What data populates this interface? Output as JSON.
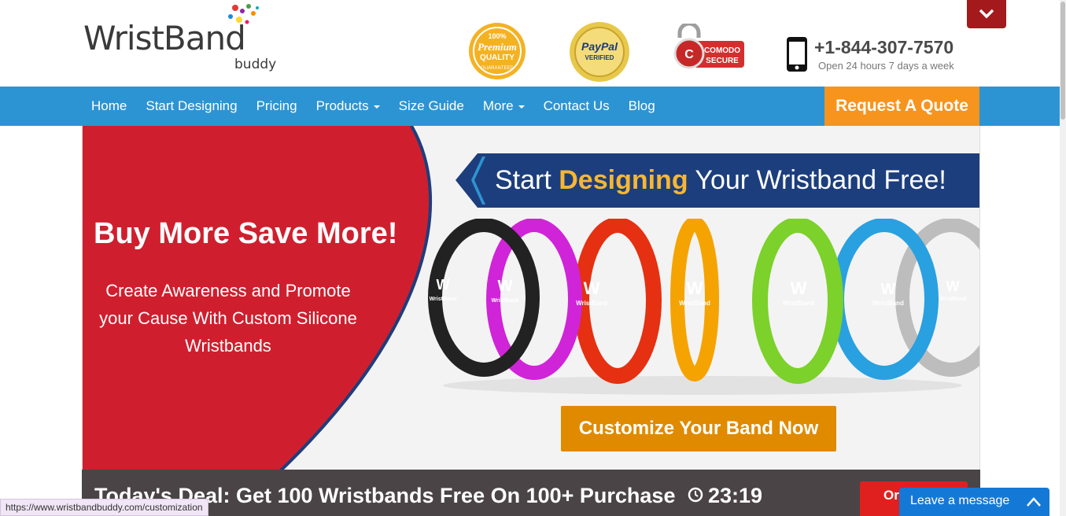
{
  "logo": {
    "word": "WristBand",
    "sub": "buddy"
  },
  "badges": {
    "quality": {
      "line1": "100%",
      "line2": "Premium",
      "line3": "QUALITY",
      "line4": "GUARANTEED"
    },
    "paypal": {
      "line1": "PayPal",
      "line2": "VERIFIED"
    },
    "comodo": {
      "line1": "COMODO",
      "line2": "SECURE"
    }
  },
  "contact": {
    "phone": "+1-844-307-7570",
    "hours": "Open 24 hours 7 days a week"
  },
  "nav": {
    "items": [
      {
        "label": "Home",
        "dropdown": false
      },
      {
        "label": "Start Designing",
        "dropdown": false
      },
      {
        "label": "Pricing",
        "dropdown": false
      },
      {
        "label": "Products",
        "dropdown": true
      },
      {
        "label": "Size Guide",
        "dropdown": false
      },
      {
        "label": "More",
        "dropdown": true
      },
      {
        "label": "Contact Us",
        "dropdown": false
      },
      {
        "label": "Blog",
        "dropdown": false
      }
    ],
    "quote_button": "Request A Quote"
  },
  "hero": {
    "headline": "Buy More Save More!",
    "subtext": "Create Awareness and Promote your Cause With Custom Silicone Wristbands",
    "banner_before": "Start ",
    "banner_highlight": "Designing",
    "banner_after": " Your Wristband  Free!",
    "band_label": "WristBand",
    "cta_button": "Customize Your Band Now"
  },
  "deal": {
    "text": "Today's Deal: Get 100 Wristbands Free On 100+ Purchase",
    "timer": "23:19",
    "order_button": "Order"
  },
  "status_bar": {
    "url": "https://www.wristbandbuddy.com/customization"
  },
  "chat": {
    "label": "Leave a message"
  },
  "colors": {
    "nav_blue": "#2d94d3",
    "quote_orange": "#f7941d",
    "hero_red": "#cf1f2e",
    "banner_navy": "#1d3e7c",
    "cta_orange": "#e08a00",
    "deal_gray": "#4a4446",
    "order_red": "#e0201f",
    "chat_blue": "#1479d6"
  }
}
